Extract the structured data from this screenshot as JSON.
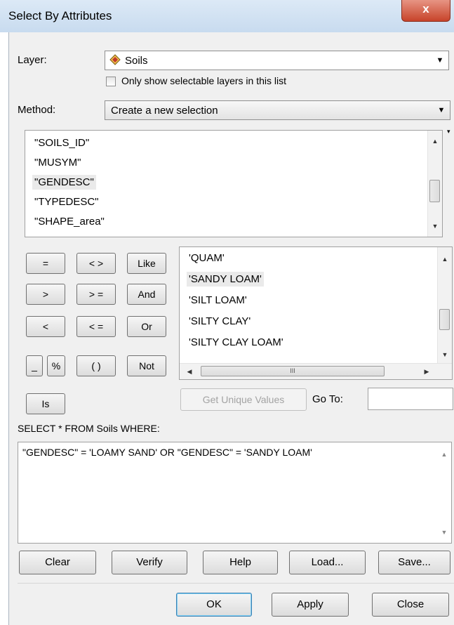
{
  "window": {
    "title": "Select By Attributes",
    "close_glyph": "x"
  },
  "layer": {
    "label": "Layer:",
    "value": "Soils",
    "icon": "polygon-layer-icon",
    "only_selectable_label": "Only show selectable layers in this list",
    "only_selectable_checked": false
  },
  "method": {
    "label": "Method:",
    "value": "Create a new selection"
  },
  "fields": {
    "items": [
      "\"SOILS_ID\"",
      "\"MUSYM\"",
      "\"GENDESC\"",
      "\"TYPEDESC\"",
      "\"SHAPE_area\""
    ],
    "selected": "\"GENDESC\""
  },
  "operators": {
    "eq": "=",
    "neq": "< >",
    "like": "Like",
    "gt": ">",
    "gte": "> =",
    "and": "And",
    "lt": "<",
    "lte": "< =",
    "or": "Or",
    "underscore": "_",
    "percent": "%",
    "parens": "( )",
    "not": "Not",
    "is": "Is"
  },
  "values": {
    "items": [
      "'QUAM'",
      "'SANDY LOAM'",
      "'SILT LOAM'",
      "'SILTY CLAY'",
      "'SILTY CLAY LOAM'"
    ],
    "selected": "'SANDY LOAM'",
    "hscroll_grip": "III"
  },
  "unique": {
    "button_label": "Get Unique Values",
    "goto_label": "Go To:",
    "goto_value": ""
  },
  "query": {
    "label": "SELECT * FROM Soils WHERE:",
    "expression": "\"GENDESC\" = 'LOAMY SAND' OR \"GENDESC\" = 'SANDY LOAM'"
  },
  "actions": {
    "clear": "Clear",
    "verify": "Verify",
    "help": "Help",
    "load": "Load...",
    "save": "Save..."
  },
  "footer": {
    "ok": "OK",
    "apply": "Apply",
    "close": "Close"
  }
}
